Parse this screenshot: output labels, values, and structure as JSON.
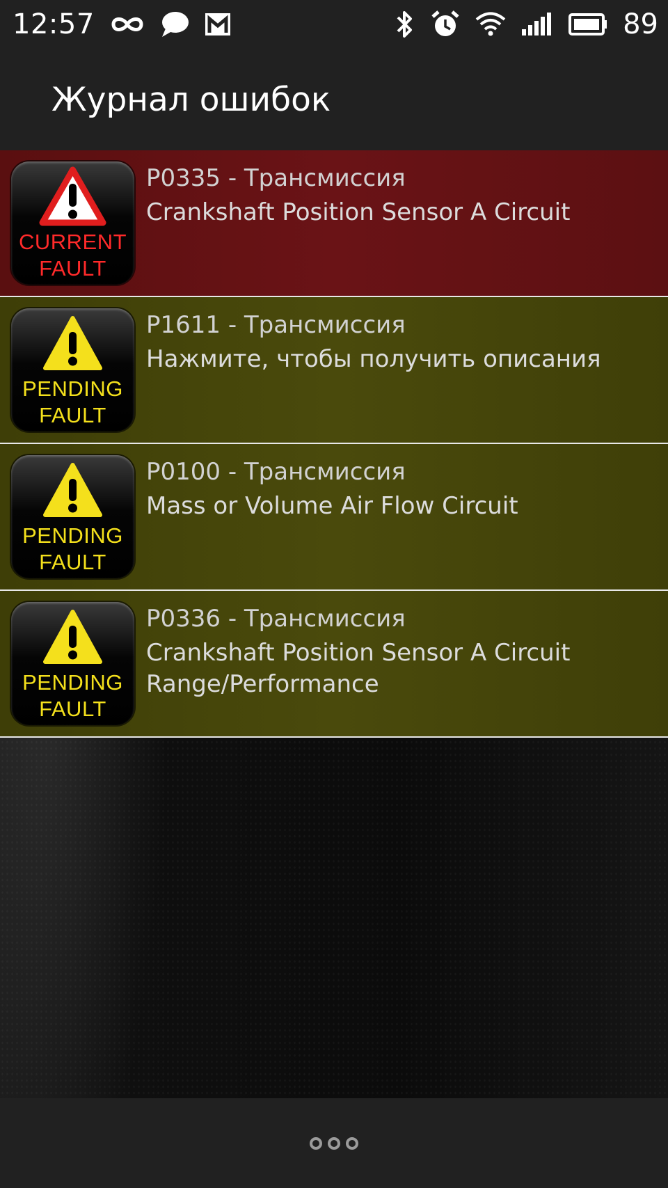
{
  "status_bar": {
    "time": "12:57",
    "battery_level": "89",
    "left_icons": [
      "infinity-icon",
      "chat-bubble-icon",
      "gmail-icon"
    ],
    "right_icons": [
      "bluetooth-icon",
      "alarm-icon",
      "wifi-icon",
      "signal-icon",
      "battery-icon"
    ]
  },
  "app_bar": {
    "title": "Журнал ошибок"
  },
  "faults": [
    {
      "status": "current",
      "badge_line1": "CURRENT",
      "badge_line2": "FAULT",
      "code": "P0335 - Трансмиссия",
      "description": "Crankshaft Position Sensor A Circuit"
    },
    {
      "status": "pending",
      "badge_line1": "PENDING",
      "badge_line2": "FAULT",
      "code": "P1611 - Трансмиссия",
      "description": "Нажмите, чтобы получить описания"
    },
    {
      "status": "pending",
      "badge_line1": "PENDING",
      "badge_line2": "FAULT",
      "code": "P0100 - Трансмиссия",
      "description": "Mass or Volume Air Flow Circuit"
    },
    {
      "status": "pending",
      "badge_line1": "PENDING",
      "badge_line2": "FAULT",
      "code": "P0336 - Трансмиссия",
      "description": "Crankshaft Position Sensor A Circuit Range/Performance"
    }
  ],
  "colors": {
    "bars": "#212121",
    "current_row": "#641215",
    "pending_row": "#46460a",
    "current_badge": "#ff2a2a",
    "pending_badge": "#f4e01c",
    "row_divider": "#e8e8e8"
  },
  "bottom_bar": {
    "overflow_icon": "overflow-menu-icon"
  }
}
